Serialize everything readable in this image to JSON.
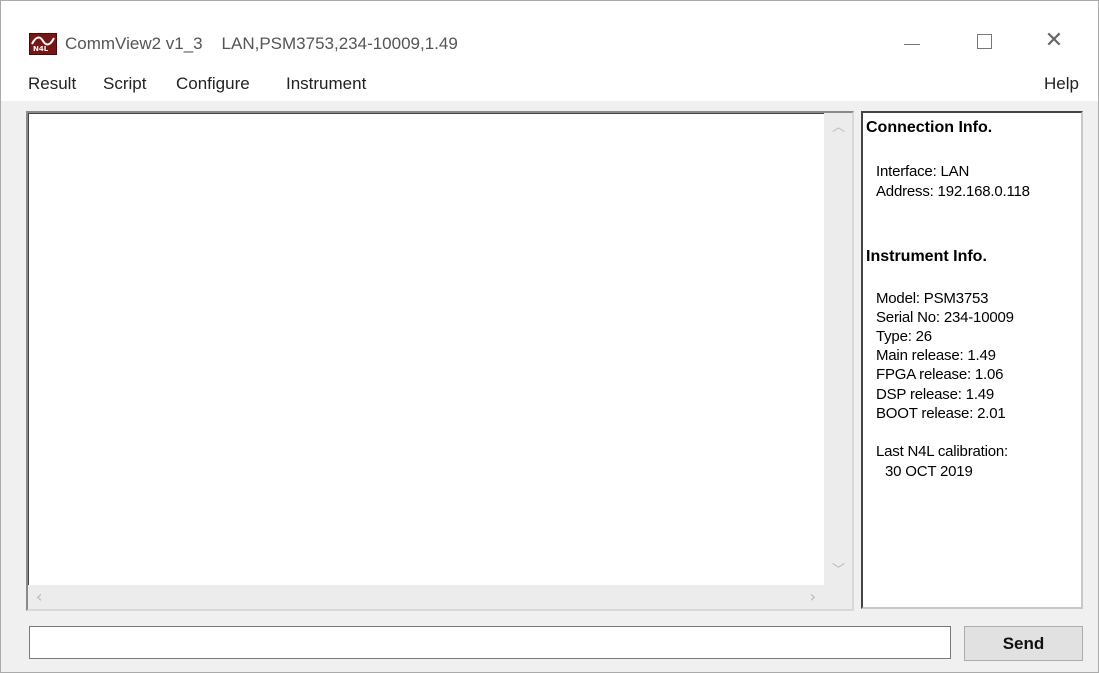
{
  "window": {
    "title": "CommView2 v1_3    LAN,PSM3753,234-10009,1.49",
    "logo_text": "N4L"
  },
  "menu": {
    "result": "Result",
    "script": "Script",
    "configure": "Configure",
    "instrument": "Instrument",
    "help": "Help"
  },
  "connection": {
    "heading": "Connection Info.",
    "interface": "Interface:  LAN",
    "address": "Address:  192.168.0.118"
  },
  "instrument": {
    "heading": "Instrument Info.",
    "model": "Model:  PSM3753",
    "serial": "Serial No:  234-10009",
    "type": "Type:  26",
    "main_release": "Main release:  1.49",
    "fpga_release": "FPGA release:  1.06",
    "dsp_release": "DSP release:  1.49",
    "boot_release": "BOOT release:  2.01",
    "calibration_label": "Last N4L calibration:",
    "calibration_date": "30 OCT 2019"
  },
  "command": {
    "value": "",
    "send_label": "Send"
  },
  "icons": {
    "app": "n4l-logo-icon",
    "minimize": "minimize-icon",
    "maximize": "maximize-icon",
    "close": "close-icon",
    "scroll_up": "chevron-up-icon",
    "scroll_down": "chevron-down-icon",
    "scroll_left": "chevron-left-icon",
    "scroll_right": "chevron-right-icon"
  },
  "colors": {
    "logo": "#7a1515",
    "window_bg": "#f0f0f0",
    "button_bg": "#e1e1e1"
  }
}
